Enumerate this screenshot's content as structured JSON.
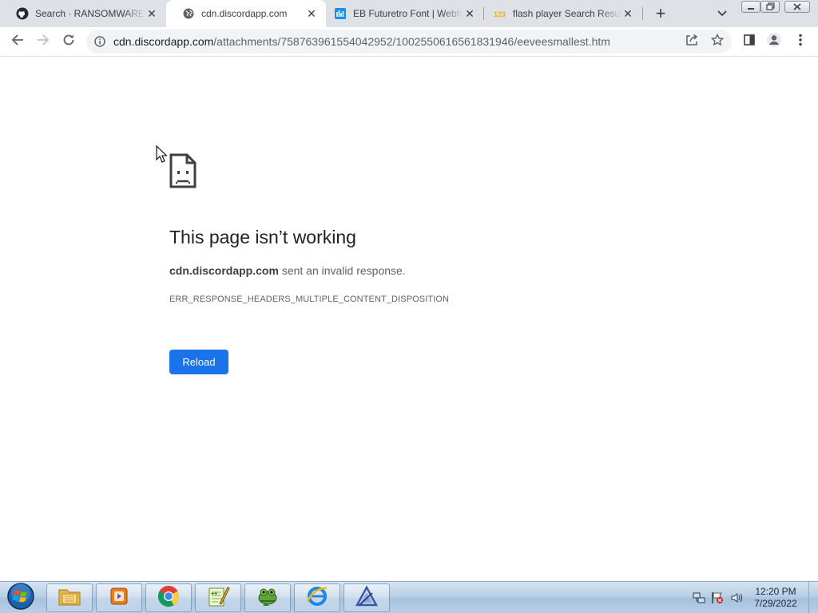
{
  "browser": {
    "tabs": [
      {
        "title": "Search · RANSOMWARE E",
        "favicon": "github-icon",
        "active": false
      },
      {
        "title": "cdn.discordapp.com",
        "favicon": "globe-icon",
        "active": true
      },
      {
        "title": "EB Futuretro Font | Webfo",
        "favicon": "fontspace-icon",
        "active": false
      },
      {
        "title": "flash player Search Result",
        "favicon": "123-icon",
        "active": false
      }
    ],
    "new_tab_label": "+",
    "address": {
      "host": "cdn.discordapp.com",
      "path": "/attachments/758763961554042952/1002550616561831946/eeveesmallest.htm"
    }
  },
  "error_page": {
    "title": "This page isn’t working",
    "host": "cdn.discordapp.com",
    "message": "sent an invalid response.",
    "code": "ERR_RESPONSE_HEADERS_MULTIPLE_CONTENT_DISPOSITION",
    "reload_label": "Reload"
  },
  "taskbar": {
    "pinned": [
      "explorer-icon",
      "media-center-icon",
      "chrome-icon",
      "notepad-plus-plus-icon",
      "frog-app-icon",
      "internet-explorer-icon",
      "app-triangle-icon"
    ],
    "clock_time": "12:20 PM",
    "clock_date": "7/29/2022"
  },
  "colors": {
    "accent": "#1a73e8",
    "tab_strip": "#dee1e6",
    "omnibox": "#f1f3f4"
  }
}
